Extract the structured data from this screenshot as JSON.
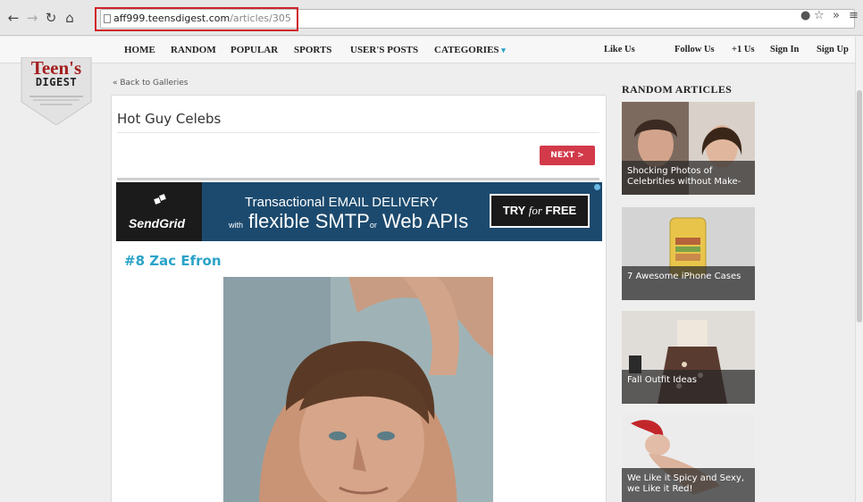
{
  "browser": {
    "url_host": "aff999.teensdigest.com",
    "url_path": "/articles/305"
  },
  "logo": {
    "title": "Teen's",
    "subtitle": "DIGEST"
  },
  "nav": {
    "items": [
      "HOME",
      "RANDOM",
      "POPULAR",
      "SPORTS",
      "USER'S POSTS",
      "CATEGORIES"
    ],
    "right": [
      "Like Us",
      "Follow Us",
      "+1 Us",
      "Sign In",
      "Sign Up"
    ]
  },
  "content": {
    "back_link": "« Back to Galleries",
    "page_title": "Hot Guy Celebs",
    "next_label": "NEXT >",
    "item_heading": "#8 Zac Efron"
  },
  "ad": {
    "brand": "SendGrid",
    "line1": "Transactional EMAIL DELIVERY",
    "line2_pre": "with",
    "line2_main1": "flexible SMTP",
    "line2_mid": "or",
    "line2_main2": "Web APIs",
    "cta_pre": "TRY",
    "cta_script": "for",
    "cta_post": "FREE"
  },
  "sidebar": {
    "title": "RANDOM ARTICLES",
    "articles": [
      {
        "caption": "Shocking Photos of Celebrities without Make-"
      },
      {
        "caption": "7 Awesome iPhone Cases"
      },
      {
        "caption": "Fall Outfit Ideas"
      },
      {
        "caption": "We Like it Spicy and Sexy, we Like it Red!"
      }
    ]
  },
  "colors": {
    "accent": "#2aa3c8",
    "next_button": "#d23a4a",
    "logo_red": "#a42020",
    "url_highlight": "#d0232a"
  }
}
